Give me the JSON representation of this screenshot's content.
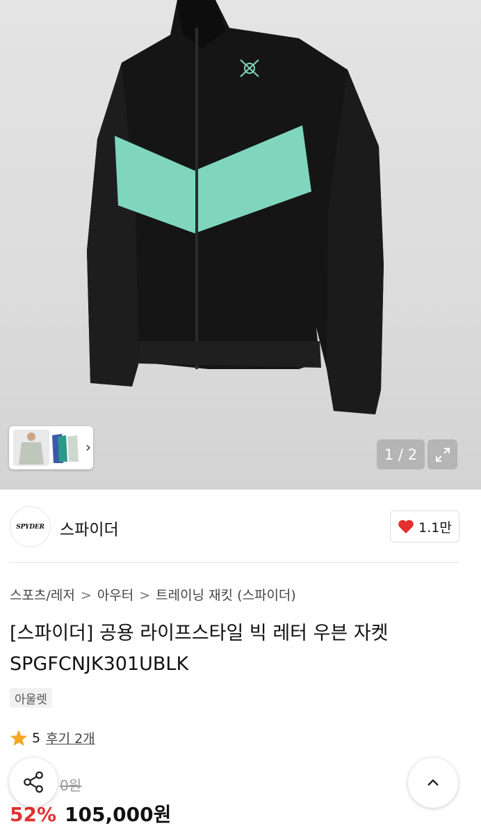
{
  "gallery": {
    "counter": "1 / 2",
    "thumb_icons": [
      "thumbnail-white-jacket",
      "thumbnail-colored-jackets"
    ]
  },
  "brand": {
    "logo_text": "SPYDER",
    "name": "스파이더",
    "likes": "1.1만"
  },
  "breadcrumb": {
    "items": [
      "스포츠/레저",
      "아우터",
      "트레이닝 재킷 (스파이더)"
    ]
  },
  "product": {
    "title": "[스파이더] 공용 라이프스타일 빅 레터 우븐 자켓 SPGFCNJK301UBLK",
    "tag": "아울렛",
    "rating": "5",
    "reviews": "후기 2개",
    "original_price": "0원",
    "discount": "52%",
    "price": "105,000원"
  },
  "colors": {
    "accent": "#e2312f",
    "jacket_black": "#151515",
    "jacket_mint": "#7fd6bd"
  }
}
